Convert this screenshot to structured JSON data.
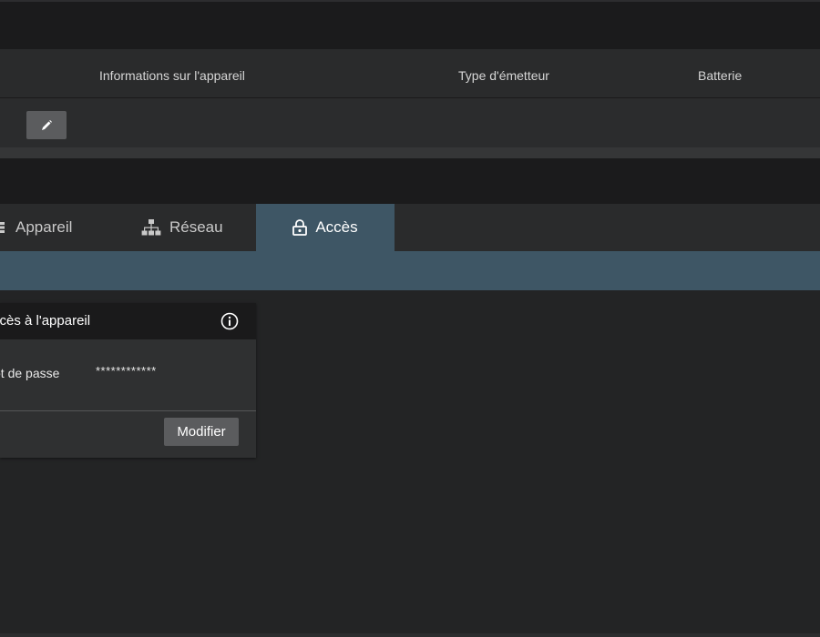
{
  "table": {
    "columns": [
      "Informations sur l'appareil",
      "Type d'émetteur",
      "Batterie"
    ],
    "edit_icon": "pencil-icon"
  },
  "tabs": [
    {
      "label": "Appareil",
      "icon": "device-icon",
      "active": false
    },
    {
      "label": "Réseau",
      "icon": "network-icon",
      "active": false
    },
    {
      "label": "Accès",
      "icon": "lock-icon",
      "active": true
    }
  ],
  "access_card": {
    "title": "ccès à l'appareil",
    "info_icon": "info-icon",
    "password_label": "ot de passe",
    "password_value": "************",
    "modify_label": "Modifier"
  },
  "colors": {
    "accent": "#3e5665",
    "background": "#232425",
    "header": "#1b1b1c",
    "button": "#5b5c5e"
  }
}
